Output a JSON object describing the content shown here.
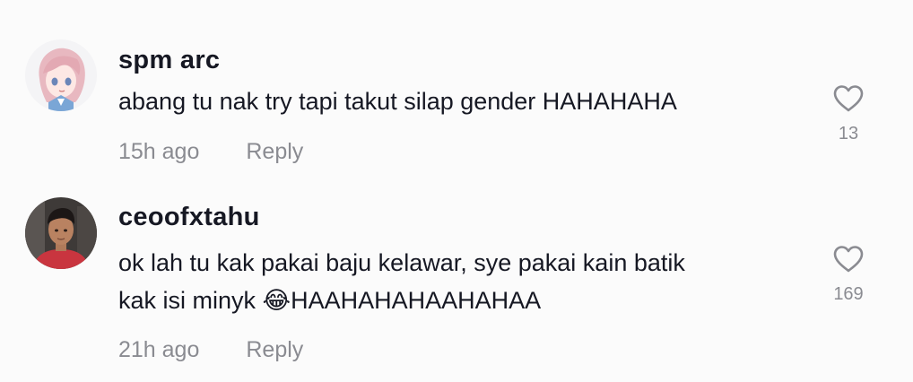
{
  "comments": [
    {
      "username": "spm arc",
      "text": "abang tu nak try tapi takut silap gender HAHAHAHA",
      "time": "15h ago",
      "reply_label": "Reply",
      "likes": "13",
      "avatar_icon": "anime-girl-avatar",
      "like_icon": "heart-outline-icon"
    },
    {
      "username": "ceoofxtahu",
      "text": "ok lah tu kak pakai baju kelawar, sye pakai kain batik\nkak isi minyk 😂HAAHAHAHAAHAHAA",
      "time": "21h ago",
      "reply_label": "Reply",
      "likes": "169",
      "avatar_icon": "person-photo-avatar",
      "like_icon": "heart-outline-icon"
    }
  ],
  "colors": {
    "background": "#fbfbfb",
    "text_primary": "#161823",
    "text_secondary": "#8a8b91"
  }
}
